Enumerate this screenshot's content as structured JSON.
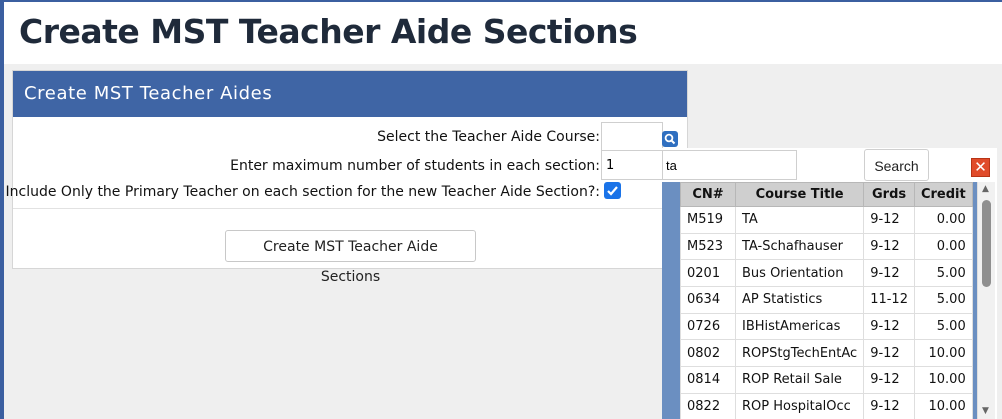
{
  "page": {
    "title": "Create MST Teacher Aide Sections"
  },
  "panel": {
    "header": "Create MST Teacher Aides",
    "course_label": "Select the Teacher Aide Course:",
    "course_value": "",
    "max_label": "Enter maximum number of students in each section:",
    "max_value": "1",
    "primary_label": "Include Only the Primary Teacher on each section for the new Teacher Aide Section?:",
    "primary_checked": true,
    "create_button": "Create MST Teacher Aide Sections"
  },
  "popup": {
    "search_value": "ta",
    "search_button": "Search",
    "close_label": "✕",
    "columns": [
      "CN#",
      "Course Title",
      "Grds",
      "Credit"
    ],
    "rows": [
      [
        "M519",
        "TA",
        "9-12",
        "0.00"
      ],
      [
        "M523",
        "TA-Schafhauser",
        "9-12",
        "0.00"
      ],
      [
        "0201",
        "Bus Orientation",
        "9-12",
        "5.00"
      ],
      [
        "0634",
        "AP Statistics",
        "11-12",
        "5.00"
      ],
      [
        "0726",
        "IBHistAmericas",
        "9-12",
        "5.00"
      ],
      [
        "0802",
        "ROPStgTechEntAc",
        "9-12",
        "10.00"
      ],
      [
        "0814",
        "ROP Retail Sale",
        "9-12",
        "10.00"
      ],
      [
        "0822",
        "ROP HospitalOcc",
        "9-12",
        "10.00"
      ]
    ]
  },
  "icons": {
    "search": "search-icon",
    "checkbox": "checkmark-icon",
    "close": "close-icon"
  }
}
